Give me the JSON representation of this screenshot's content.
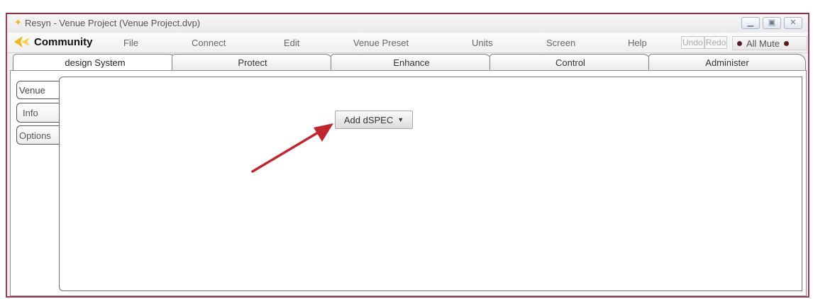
{
  "window": {
    "title": "Resyn - Venue Project (Venue Project.dvp)",
    "controls": [
      "minimize-icon",
      "maximize-icon",
      "close-icon"
    ]
  },
  "menubar": {
    "brand": "Community",
    "items": [
      "File",
      "Connect",
      "Edit",
      "Venue Preset",
      "Units",
      "Screen",
      "Help"
    ],
    "undo": "Undo",
    "redo": "Redo",
    "all_mute": "All Mute"
  },
  "tabs": [
    "design System",
    "Protect",
    "Enhance",
    "Control",
    "Administer"
  ],
  "active_tab": "design System",
  "side_tabs": [
    "Venue",
    "Info",
    "Options"
  ],
  "active_side_tab": "Venue",
  "main": {
    "add_button_label": "Add dSPEC"
  },
  "colors": {
    "window_border": "#9b3b55",
    "arrow": "#c0272d",
    "logo": "#f2b616"
  }
}
